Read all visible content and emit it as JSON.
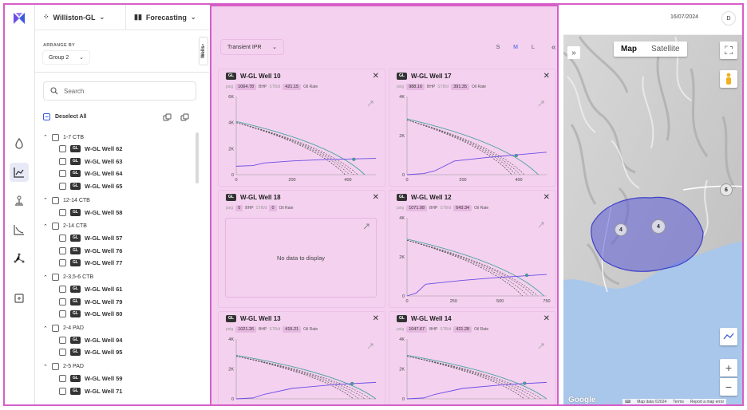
{
  "topbar": {
    "asset": "Williston-GL",
    "module": "Forecasting"
  },
  "sidebar": {
    "arrange_label": "ARRANGE BY",
    "group_value": "Group 2",
    "wells_tab": "Wells",
    "search_placeholder": "Search",
    "deselect_label": "Deselect All",
    "tag": "GL",
    "groups": [
      {
        "name": "1-7 CTB",
        "wells": [
          "W-GL Well 62",
          "W-GL Well 63",
          "W-GL Well 64",
          "W-GL Well 65"
        ]
      },
      {
        "name": "12-14 CTB",
        "wells": [
          "W-GL Well 58"
        ]
      },
      {
        "name": "2-14 CTB",
        "wells": [
          "W-GL Well 57",
          "W-GL Well 76",
          "W-GL Well 77"
        ]
      },
      {
        "name": "2-3,5-6 CTB",
        "wells": [
          "W-GL Well 61",
          "W-GL Well 79",
          "W-GL Well 80"
        ]
      },
      {
        "name": "2-4 PAD",
        "wells": [
          "W-GL Well 94",
          "W-GL Well 95"
        ]
      },
      {
        "name": "2-5 PAD",
        "wells": [
          "W-GL Well 59",
          "W-GL Well 71"
        ]
      }
    ]
  },
  "center": {
    "mode": "Transient IPR",
    "sizes": [
      "S",
      "M",
      "L"
    ],
    "collapse": "«",
    "labels": {
      "psig": "psig",
      "bhp": "BHP",
      "stbd": "STB/d",
      "oil": "Oil Rate"
    },
    "cards": [
      {
        "title": "W-GL Well 10",
        "psig": "1064.78",
        "stbd": "421.15",
        "nodata": false,
        "chart": {
          "ymax": 6000,
          "yticks": [
            "0",
            "2K",
            "4K",
            "6K"
          ],
          "xmax": 500,
          "xticks": [
            [
              "0",
              0
            ],
            [
              "200",
              200
            ],
            [
              "400",
              400
            ]
          ],
          "start": 4000,
          "ends": [
            390,
            405,
            420,
            435
          ],
          "ipr_end": 460,
          "vlp": [
            [
              0,
              650
            ],
            [
              60,
              700
            ],
            [
              100,
              900
            ],
            [
              200,
              1050
            ],
            [
              300,
              1150
            ],
            [
              500,
              1250
            ]
          ],
          "op": [
            421,
            1180
          ]
        }
      },
      {
        "title": "W-GL Well 17",
        "psig": "988.16",
        "stbd": "391.35",
        "nodata": false,
        "chart": {
          "ymax": 4000,
          "yticks": [
            "0",
            "2K",
            "4K"
          ],
          "xmax": 500,
          "xticks": [
            [
              "0",
              0
            ],
            [
              "200",
              200
            ],
            [
              "400",
              400
            ]
          ],
          "start": 2800,
          "ends": [
            375,
            390,
            405,
            420
          ],
          "ipr_end": 470,
          "vlp": [
            [
              0,
              0
            ],
            [
              60,
              60
            ],
            [
              100,
              200
            ],
            [
              170,
              700
            ],
            [
              300,
              900
            ],
            [
              500,
              1150
            ]
          ],
          "op": [
            391,
            980
          ]
        }
      },
      {
        "title": "W-GL Well 18",
        "psig": "0",
        "stbd": "0",
        "nodata": true,
        "nodata_text": "No data to display"
      },
      {
        "title": "W-GL Well 12",
        "psig": "1071.08",
        "stbd": "643.34",
        "nodata": false,
        "chart": {
          "ymax": 4000,
          "yticks": [
            "0",
            "2K",
            "4K"
          ],
          "xmax": 750,
          "xticks": [
            [
              "0",
              0
            ],
            [
              "250",
              250
            ],
            [
              "500",
              500
            ],
            [
              "750",
              750
            ]
          ],
          "start": 2850,
          "ends": [
            620,
            650,
            680,
            700
          ],
          "ipr_end": 735,
          "vlp": [
            [
              0,
              0
            ],
            [
              50,
              150
            ],
            [
              100,
              600
            ],
            [
              300,
              800
            ],
            [
              500,
              950
            ],
            [
              750,
              1100
            ]
          ],
          "op": [
            643,
            1060
          ]
        }
      },
      {
        "title": "W-GL Well 13",
        "psig": "1021.26",
        "stbd": "415.21",
        "nodata": false,
        "chart": {
          "ymax": 4000,
          "yticks": [
            "0",
            "2K",
            "4K"
          ],
          "xmax": 500,
          "xticks": [],
          "start": 2850,
          "ends": [
            420,
            440,
            460,
            480
          ],
          "ipr_end": 500,
          "vlp": [
            [
              0,
              0
            ],
            [
              60,
              60
            ],
            [
              100,
              300
            ],
            [
              200,
              700
            ],
            [
              350,
              950
            ],
            [
              500,
              1100
            ]
          ],
          "op": [
            415,
            1020
          ]
        }
      },
      {
        "title": "W-GL Well 14",
        "psig": "1047.67",
        "stbd": "421.28",
        "nodata": false,
        "chart": {
          "ymax": 4000,
          "yticks": [
            "0",
            "2K",
            "4K"
          ],
          "xmax": 500,
          "xticks": [],
          "start": 2850,
          "ends": [
            420,
            440,
            460,
            480
          ],
          "ipr_end": 500,
          "vlp": [
            [
              0,
              0
            ],
            [
              60,
              60
            ],
            [
              100,
              300
            ],
            [
              200,
              700
            ],
            [
              350,
              950
            ],
            [
              500,
              1100
            ]
          ],
          "op": [
            421,
            1040
          ]
        }
      }
    ]
  },
  "map": {
    "date": "16/07/2024",
    "user": "D",
    "map_btn": "Map",
    "sat_btn": "Satellite",
    "expand": "»",
    "clusters": [
      "4",
      "4",
      "6"
    ],
    "zoom_in": "+",
    "zoom_out": "−",
    "google": "Google",
    "attrib": [
      "Map data ©2024",
      "Terms",
      "Report a map error"
    ]
  },
  "colors": {
    "accent": "#3b5bdb",
    "highlight": "#d65fc7",
    "ipr": "#4aa3a1",
    "vlp": "#6b4de6",
    "polygon": "#5b5bd6"
  }
}
